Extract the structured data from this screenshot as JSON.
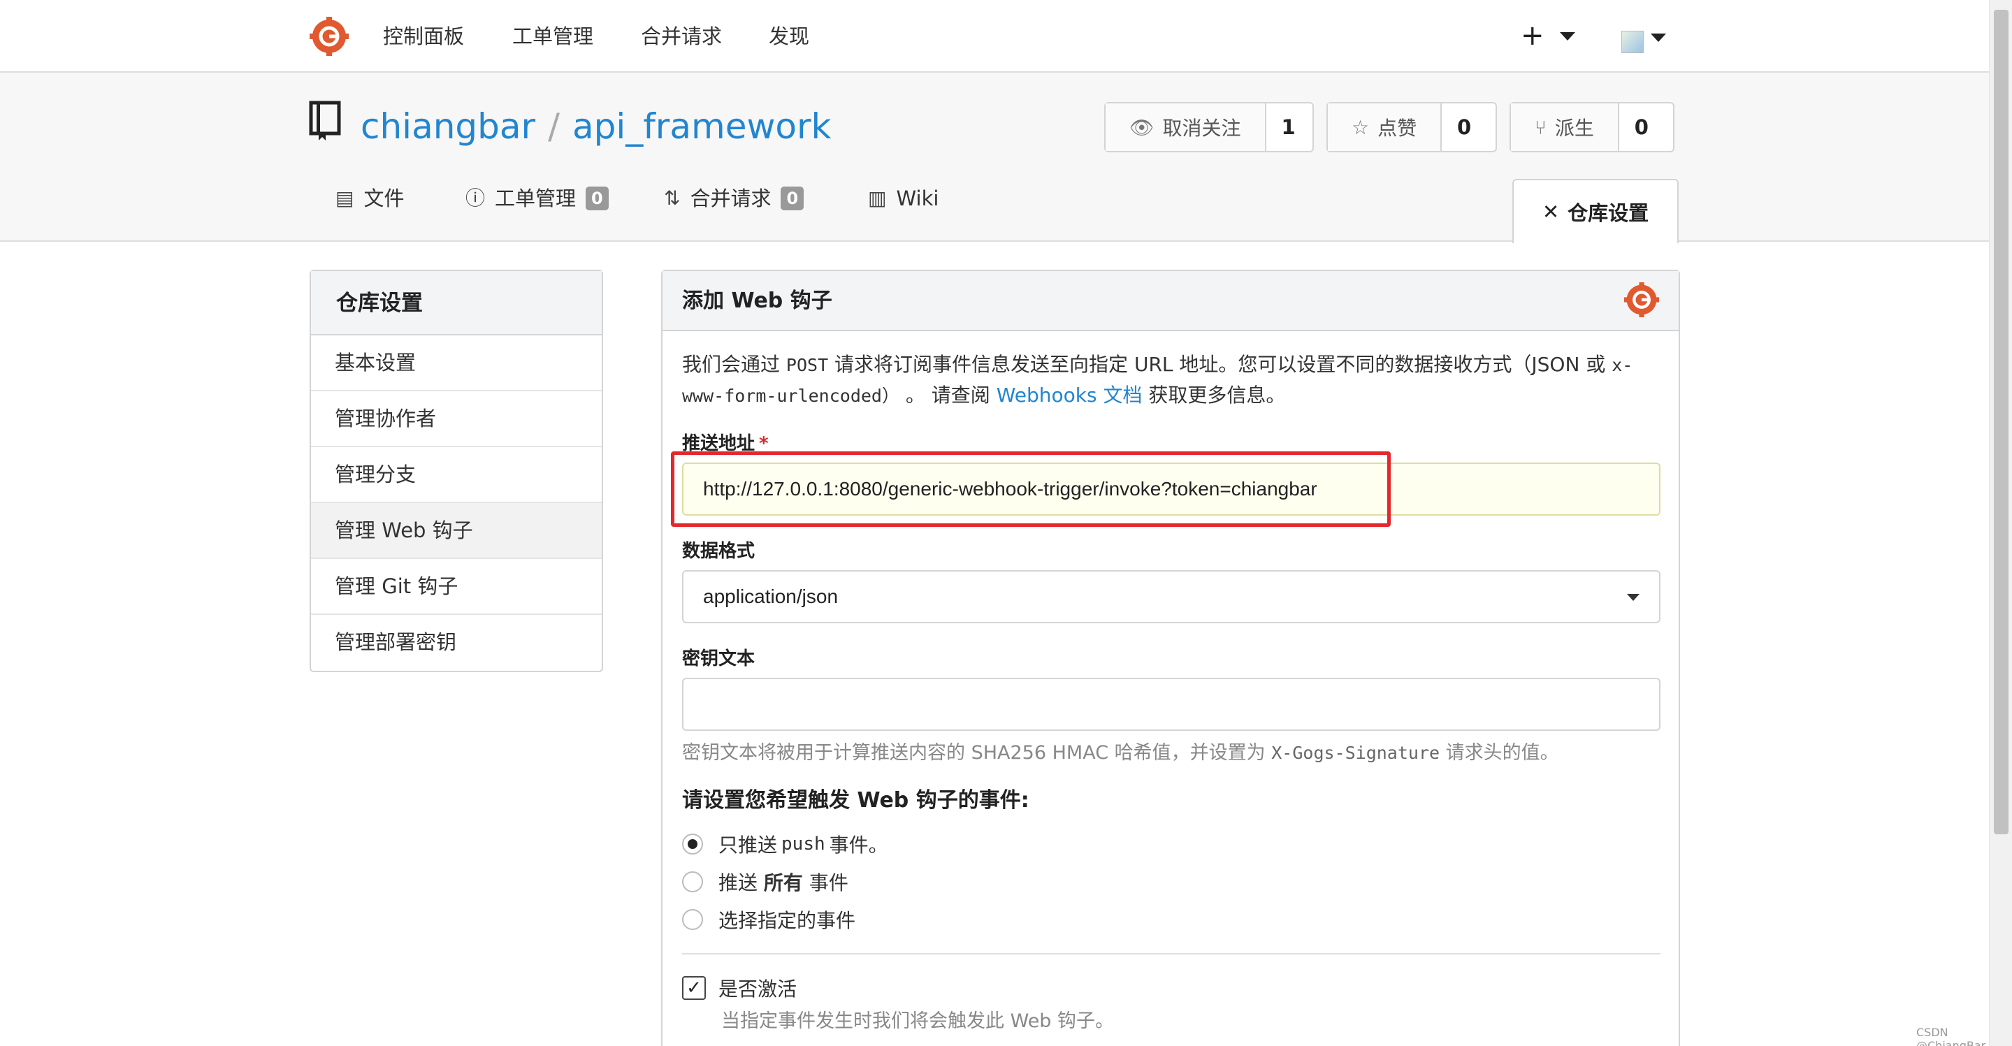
{
  "topnav": {
    "items": [
      "控制面板",
      "工单管理",
      "合并请求",
      "发现"
    ],
    "plus": "+"
  },
  "repo": {
    "owner": "chiangbar",
    "separator": "/",
    "name": "api_framework",
    "watch": {
      "label": "取消关注",
      "count": "1"
    },
    "star": {
      "label": "点赞",
      "count": "0"
    },
    "fork": {
      "label": "派生",
      "count": "0"
    },
    "tabs": [
      {
        "label": "文件"
      },
      {
        "label": "工单管理",
        "badge": "0"
      },
      {
        "label": "合并请求",
        "badge": "0"
      },
      {
        "label": "Wiki"
      }
    ],
    "active_tab": "仓库设置"
  },
  "sidebar": {
    "title": "仓库设置",
    "items": [
      "基本设置",
      "管理协作者",
      "管理分支",
      "管理 Web 钩子",
      "管理 Git 钩子",
      "管理部署密钥"
    ]
  },
  "form": {
    "title": "添加 Web 钩子",
    "desc_1": "我们会通过",
    "desc_post": "POST",
    "desc_2": "请求将订阅事件信息发送至向指定 URL 地址。您可以设置不同的数据接收方式（JSON 或",
    "desc_mono": "x-www-form-urlencoded）",
    "desc_3": "。 请查阅",
    "desc_link": "Webhooks 文档",
    "desc_4": "获取更多信息。",
    "payload_label": "推送地址",
    "required_mark": "*",
    "payload_value": "http://127.0.0.1:8080/generic-webhook-trigger/invoke?token=chiangbar",
    "content_type_label": "数据格式",
    "content_type_value": "application/json",
    "secret_label": "密钥文本",
    "secret_value": "",
    "secret_help_1": "密钥文本将被用于计算推送内容的 SHA256 HMAC 哈希值，并设置为",
    "secret_help_mono": "X-Gogs-Signature",
    "secret_help_2": "请求头的值。",
    "events_title": "请设置您希望触发 Web 钩子的事件:",
    "events": {
      "push_a": "只推送",
      "push_mono": "push",
      "push_b": "事件。",
      "all_a": "推送",
      "all_bold": "所有",
      "all_b": "事件",
      "choose": "选择指定的事件"
    },
    "active_label": "是否激活",
    "active_help": "当指定事件发生时我们将会触发此 Web 钩子。"
  },
  "watermark": "CSDN @ChiangBar"
}
